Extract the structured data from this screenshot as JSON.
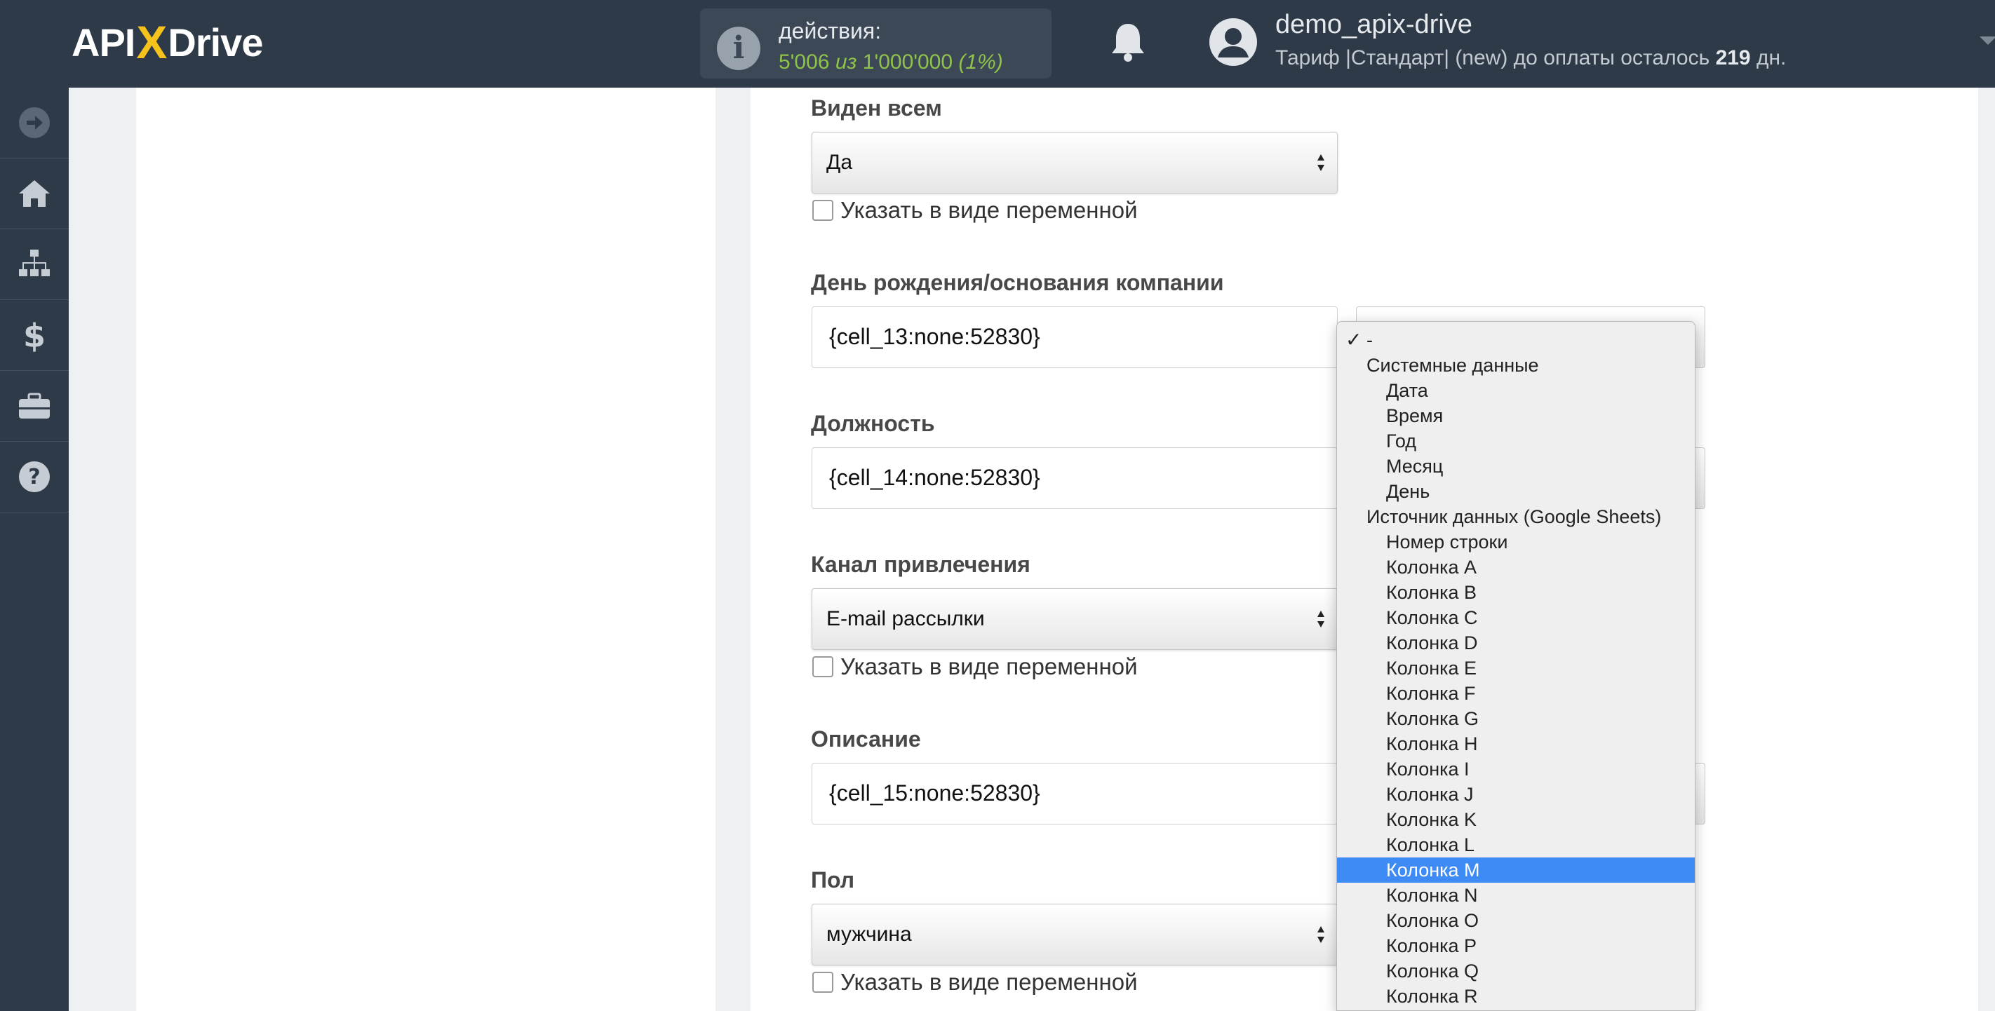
{
  "header": {
    "logo_left": "API",
    "logo_x": "X",
    "logo_right": "Drive",
    "actions_label": "действия:",
    "actions_used": "5'006",
    "actions_of": "из",
    "actions_total": "1'000'000",
    "actions_pct": "(1%)",
    "user_name": "demo_apix-drive",
    "tariff_text": "Тариф |Стандарт| (new) до оплаты осталось",
    "tariff_days": "219",
    "tariff_suffix": "дн."
  },
  "sidenav": {
    "items": [
      "arrow-right-icon",
      "home-icon",
      "sitemap-icon",
      "dollar-icon",
      "briefcase-icon",
      "help-icon"
    ]
  },
  "form": {
    "visible_label": "Виден всем",
    "visible_value": "Да",
    "variable_checkbox_label": "Указать в виде переменной",
    "birthday_label": "День рождения/основания компании",
    "birthday_value": "{cell_13:none:52830}",
    "position_label": "Должность",
    "position_value": "{cell_14:none:52830}",
    "channel_label": "Канал привлечения",
    "channel_value": "E-mail рассылки",
    "description_label": "Описание",
    "description_value": "{cell_15:none:52830}",
    "gender_label": "Пол",
    "gender_value": "мужчина"
  },
  "dropdown": {
    "checkmark": "✓",
    "first": "-",
    "group_system": "Системные данные",
    "system_options": [
      "Дата",
      "Время",
      "Год",
      "Месяц",
      "День"
    ],
    "group_source": "Источник данных (Google Sheets)",
    "source_options": [
      "Номер строки",
      "Колонка A",
      "Колонка B",
      "Колонка C",
      "Колонка D",
      "Колонка E",
      "Колонка F",
      "Колонка G",
      "Колонка H",
      "Колонка I",
      "Колонка J",
      "Колонка K",
      "Колонка L",
      "Колонка M",
      "Колонка N",
      "Колонка O",
      "Колонка P",
      "Колонка Q",
      "Колонка R"
    ],
    "selected": "Колонка M"
  },
  "colors": {
    "header_bg": "#2e3a48",
    "accent_green": "#8fc24a",
    "logo_yellow": "#f6c21c",
    "selected_blue": "#3f8bf5"
  }
}
